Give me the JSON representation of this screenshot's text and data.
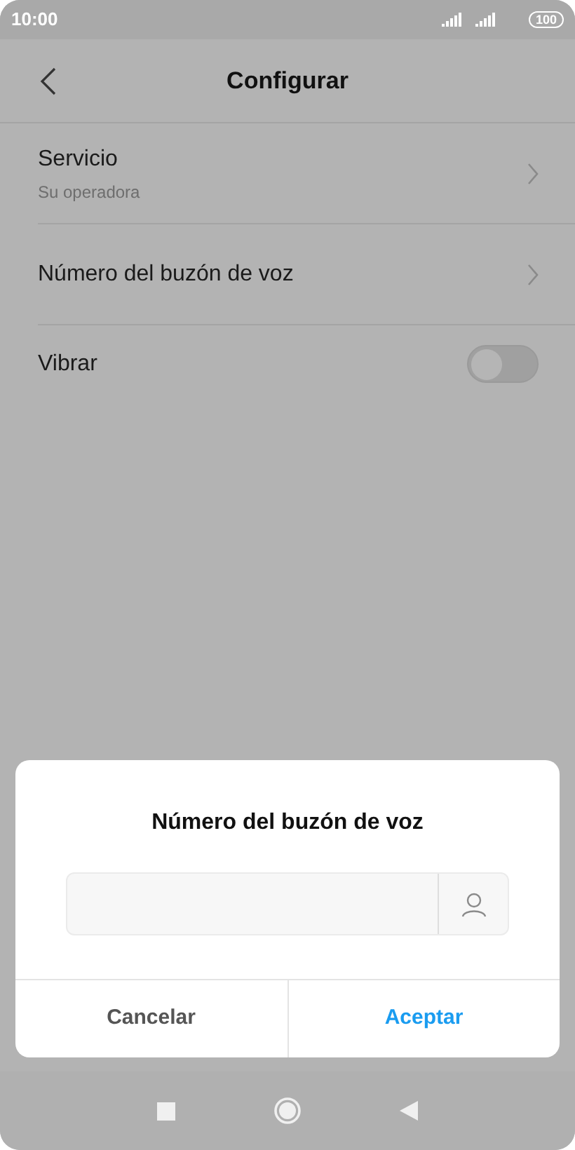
{
  "status_bar": {
    "time": "10:00",
    "battery": "100"
  },
  "header": {
    "title": "Configurar"
  },
  "settings": [
    {
      "kind": "nav",
      "label": "Servicio",
      "subtitle": "Su operadora"
    },
    {
      "kind": "nav",
      "label": "Número del buzón de voz"
    },
    {
      "kind": "toggle",
      "label": "Vibrar",
      "on": false
    }
  ],
  "dialog": {
    "title": "Número del buzón de voz",
    "buttons": [
      {
        "label": "Cancelar",
        "primary": false
      },
      {
        "label": "Aceptar",
        "primary": true
      }
    ]
  }
}
